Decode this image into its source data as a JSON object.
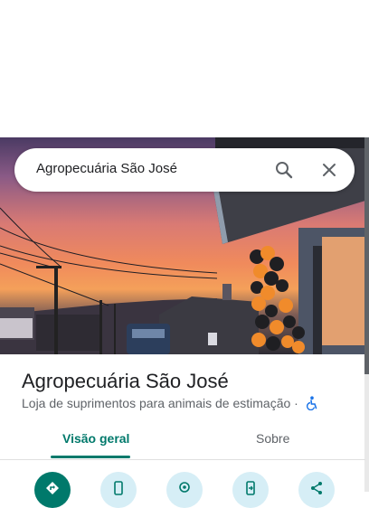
{
  "search": {
    "query": "Agropecuária São José"
  },
  "place": {
    "name": "Agropecuária São José",
    "category": "Loja de suprimentos para animais de estimação",
    "separator": "·"
  },
  "tabs": [
    {
      "label": "Visão geral",
      "selected": true
    },
    {
      "label": "Sobre",
      "selected": false
    }
  ],
  "actions": [
    {
      "icon": "directions-icon"
    },
    {
      "icon": "phone-icon"
    },
    {
      "icon": "save-location-icon"
    },
    {
      "icon": "send-to-phone-icon"
    },
    {
      "icon": "share-icon"
    }
  ],
  "colors": {
    "accent": "#00796b",
    "action_bg": "#d6eef6",
    "accessibility": "#1a73e8"
  }
}
